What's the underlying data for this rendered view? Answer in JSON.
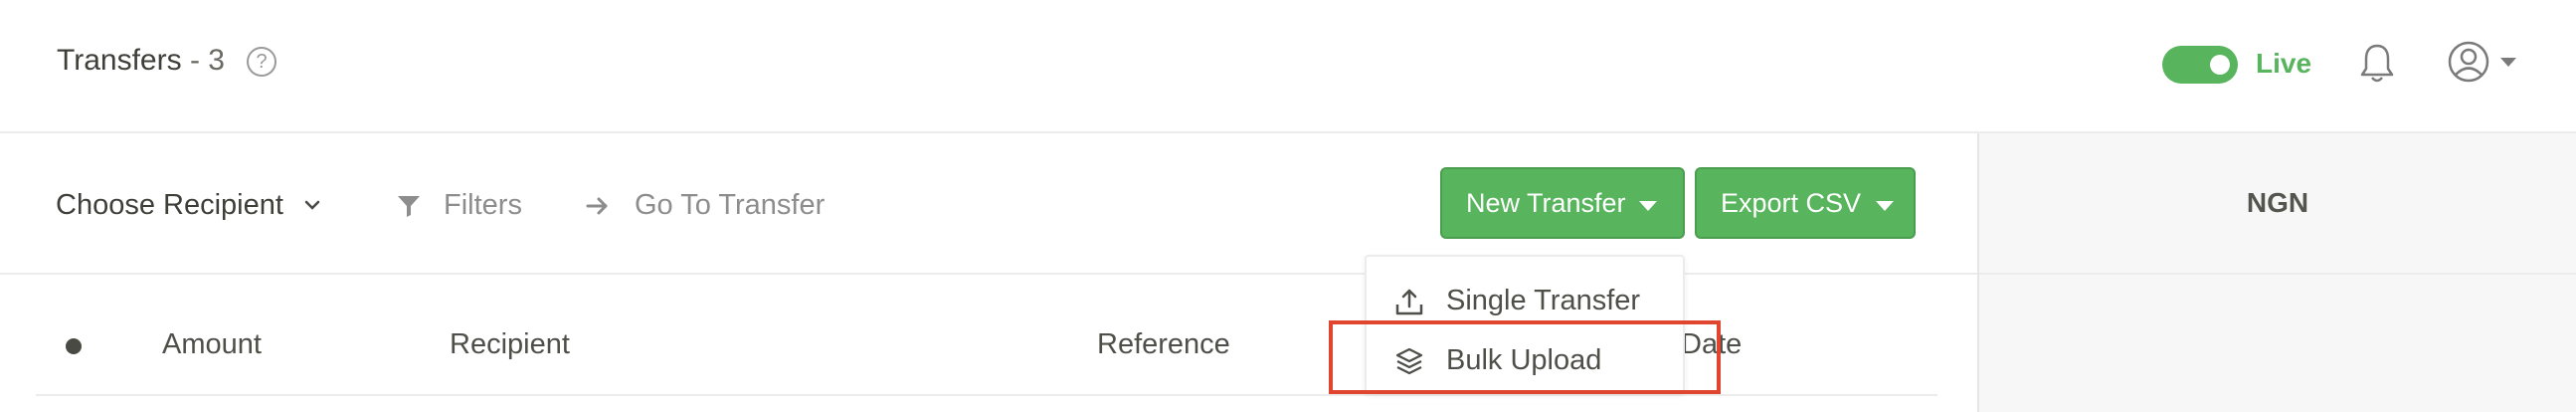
{
  "header": {
    "title": "Transfers",
    "count": "- 3",
    "help_glyph": "?",
    "live_label": "Live",
    "accent_color": "#58b45d"
  },
  "toolbar": {
    "choose_recipient": "Choose Recipient",
    "filters": "Filters",
    "go_to_transfer": "Go To Transfer",
    "new_transfer": "New Transfer",
    "export_csv": "Export CSV"
  },
  "side_panel": {
    "currency": "NGN"
  },
  "table": {
    "columns": [
      "Amount",
      "Recipient",
      "Reference",
      "Date"
    ]
  },
  "new_transfer_menu": {
    "items": [
      {
        "label": "Single Transfer",
        "icon": "upload-icon"
      },
      {
        "label": "Bulk Upload",
        "icon": "layers-icon"
      }
    ],
    "highlighted_item": "Bulk Upload",
    "highlight_color": "#e0462f"
  }
}
